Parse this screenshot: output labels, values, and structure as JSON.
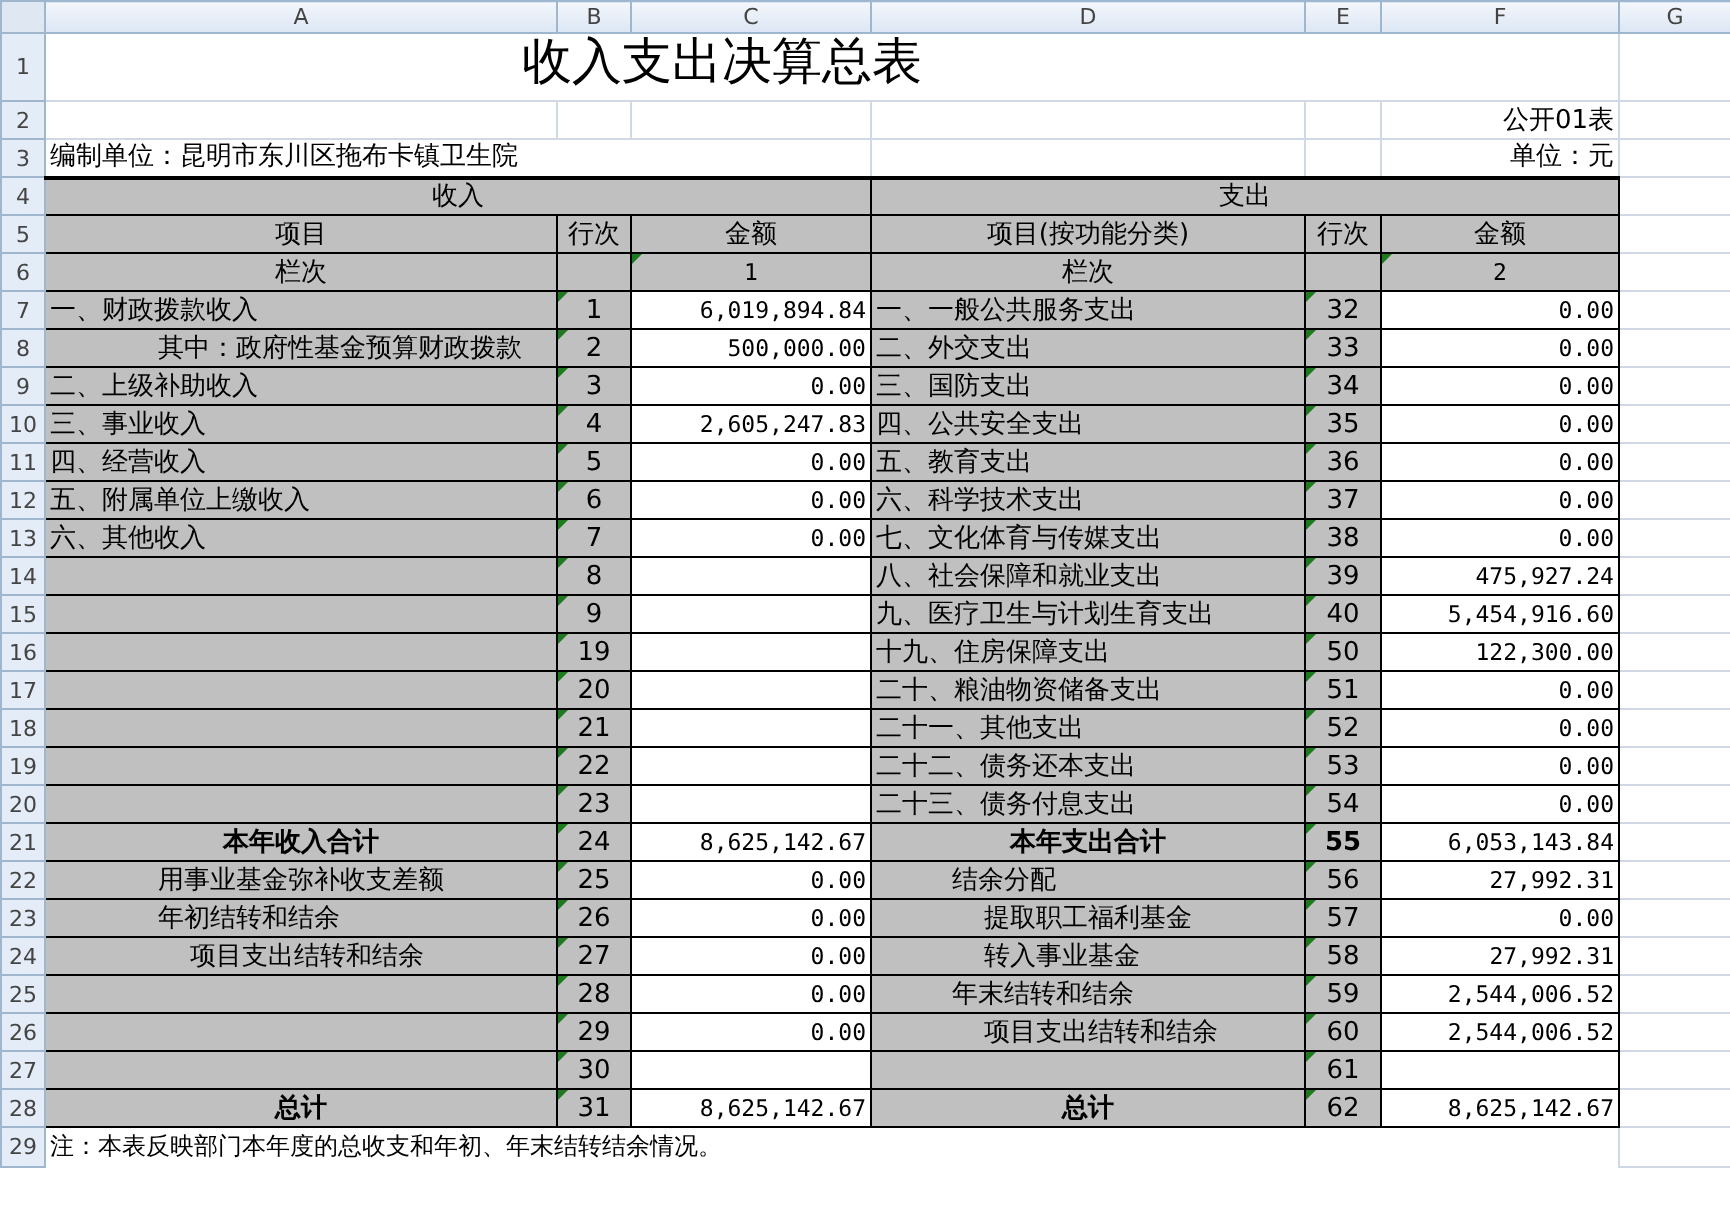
{
  "column_headers": [
    "A",
    "B",
    "C",
    "D",
    "E",
    "F",
    "G"
  ],
  "row_numbers": [
    "1",
    "2",
    "3",
    "4",
    "5",
    "6",
    "7",
    "8",
    "9",
    "10",
    "11",
    "12",
    "13",
    "14",
    "15",
    "16",
    "17",
    "18",
    "19",
    "20",
    "21",
    "22",
    "23",
    "24",
    "25",
    "26",
    "27",
    "28",
    "29"
  ],
  "title": "收入支出决算总表",
  "form_number": "公开01表",
  "compiling_unit": "编制单位：昆明市东川区拖布卡镇卫生院",
  "currency_unit": "单位：元",
  "income_header": "收入",
  "expense_header": "支出",
  "income_columns": [
    "项目",
    "行次",
    "金额"
  ],
  "expense_columns": [
    "项目(按功能分类)",
    "行次",
    "金额"
  ],
  "index_row": {
    "income_label": "栏次",
    "income_index": "1",
    "expense_label": "栏次",
    "expense_index": "2"
  },
  "rows": [
    {
      "income": {
        "item": "一、财政拨款收入",
        "kind": "item",
        "line": "1",
        "amount": "6,019,894.84"
      },
      "expense": {
        "item": "一、一般公共服务支出",
        "kind": "item",
        "line": "32",
        "line_bold": false,
        "amount": "0.00"
      }
    },
    {
      "income": {
        "item": "其中：政府性基金预算财政拨款",
        "kind": "indent2",
        "line": "2",
        "amount": "500,000.00"
      },
      "expense": {
        "item": "二、外交支出",
        "kind": "item",
        "line": "33",
        "line_bold": false,
        "amount": "0.00"
      }
    },
    {
      "income": {
        "item": "二、上级补助收入",
        "kind": "item",
        "line": "3",
        "amount": "0.00"
      },
      "expense": {
        "item": "三、国防支出",
        "kind": "item",
        "line": "34",
        "line_bold": false,
        "amount": "0.00"
      }
    },
    {
      "income": {
        "item": "三、事业收入",
        "kind": "item",
        "line": "4",
        "amount": "2,605,247.83"
      },
      "expense": {
        "item": "四、公共安全支出",
        "kind": "item",
        "line": "35",
        "line_bold": false,
        "amount": "0.00"
      }
    },
    {
      "income": {
        "item": "四、经营收入",
        "kind": "item",
        "line": "5",
        "amount": "0.00"
      },
      "expense": {
        "item": "五、教育支出",
        "kind": "item",
        "line": "36",
        "line_bold": false,
        "amount": "0.00"
      }
    },
    {
      "income": {
        "item": "五、附属单位上缴收入",
        "kind": "item",
        "line": "6",
        "amount": "0.00"
      },
      "expense": {
        "item": "六、科学技术支出",
        "kind": "item",
        "line": "37",
        "line_bold": false,
        "amount": "0.00"
      }
    },
    {
      "income": {
        "item": "六、其他收入",
        "kind": "item",
        "line": "7",
        "amount": "0.00"
      },
      "expense": {
        "item": "七、文化体育与传媒支出",
        "kind": "item",
        "line": "38",
        "line_bold": false,
        "amount": "0.00"
      }
    },
    {
      "income": {
        "kind": "item",
        "line": "8"
      },
      "expense": {
        "item": "八、社会保障和就业支出",
        "kind": "item",
        "line": "39",
        "line_bold": false,
        "amount": "475,927.24"
      }
    },
    {
      "income": {
        "kind": "item",
        "line": "9"
      },
      "expense": {
        "item": "九、医疗卫生与计划生育支出",
        "kind": "item",
        "line": "40",
        "line_bold": false,
        "amount": "5,454,916.60"
      }
    },
    {
      "income": {
        "kind": "item",
        "line": "19"
      },
      "expense": {
        "item": "十九、住房保障支出",
        "kind": "item",
        "line": "50",
        "line_bold": false,
        "amount": "122,300.00"
      }
    },
    {
      "income": {
        "kind": "item",
        "line": "20"
      },
      "expense": {
        "item": "二十、粮油物资储备支出",
        "kind": "item",
        "line": "51",
        "line_bold": false,
        "amount": "0.00"
      }
    },
    {
      "income": {
        "kind": "item",
        "line": "21"
      },
      "expense": {
        "item": "二十一、其他支出",
        "kind": "item",
        "line": "52",
        "line_bold": false,
        "amount": "0.00"
      }
    },
    {
      "income": {
        "kind": "item",
        "line": "22"
      },
      "expense": {
        "item": "二十二、债务还本支出",
        "kind": "item",
        "line": "53",
        "line_bold": false,
        "amount": "0.00"
      }
    },
    {
      "income": {
        "kind": "item",
        "line": "23"
      },
      "expense": {
        "item": "二十三、债务付息支出",
        "kind": "item",
        "line": "54",
        "line_bold": false,
        "amount": "0.00"
      }
    },
    {
      "income": {
        "item": "本年收入合计",
        "kind": "total",
        "line": "24",
        "amount": "8,625,142.67"
      },
      "expense": {
        "item": "本年支出合计",
        "kind": "total",
        "line": "55",
        "line_bold": true,
        "amount": "6,053,143.84"
      }
    },
    {
      "income": {
        "item": "用事业基金弥补收支差额",
        "kind": "indent3",
        "line": "25",
        "amount": "0.00"
      },
      "expense": {
        "item": "结余分配",
        "kind": "indent1",
        "line": "56",
        "line_bold": false,
        "amount": "27,992.31"
      }
    },
    {
      "income": {
        "item": "年初结转和结余",
        "kind": "indent3",
        "line": "26",
        "amount": "0.00"
      },
      "expense": {
        "item": "提取职工福利基金",
        "kind": "indent2",
        "line": "57",
        "line_bold": false,
        "amount": "0.00"
      }
    },
    {
      "income": {
        "item": "项目支出结转和结余",
        "kind": "indent4",
        "line": "27",
        "amount": "0.00"
      },
      "expense": {
        "item": "转入事业基金",
        "kind": "indent2",
        "line": "58",
        "line_bold": false,
        "amount": "27,992.31"
      }
    },
    {
      "income": {
        "kind": "item",
        "line": "28",
        "amount": "0.00"
      },
      "expense": {
        "item": "年末结转和结余",
        "kind": "indent1",
        "line": "59",
        "line_bold": false,
        "amount": "2,544,006.52"
      }
    },
    {
      "income": {
        "kind": "item",
        "line": "29",
        "amount": "0.00"
      },
      "expense": {
        "item": "项目支出结转和结余",
        "kind": "indent2",
        "line": "60",
        "line_bold": false,
        "amount": "2,544,006.52"
      }
    },
    {
      "income": {
        "kind": "item",
        "line": "30"
      },
      "expense": {
        "kind": "item",
        "line": "61",
        "line_bold": false
      }
    },
    {
      "income": {
        "item": "总计",
        "kind": "total",
        "line": "31",
        "amount": "8,625,142.67"
      },
      "expense": {
        "item": "总计",
        "kind": "total",
        "line": "62",
        "line_bold": false,
        "amount": "8,625,142.67"
      }
    }
  ],
  "note": "注：本表反映部门本年度的总收支和年初、年末结转结余情况。"
}
